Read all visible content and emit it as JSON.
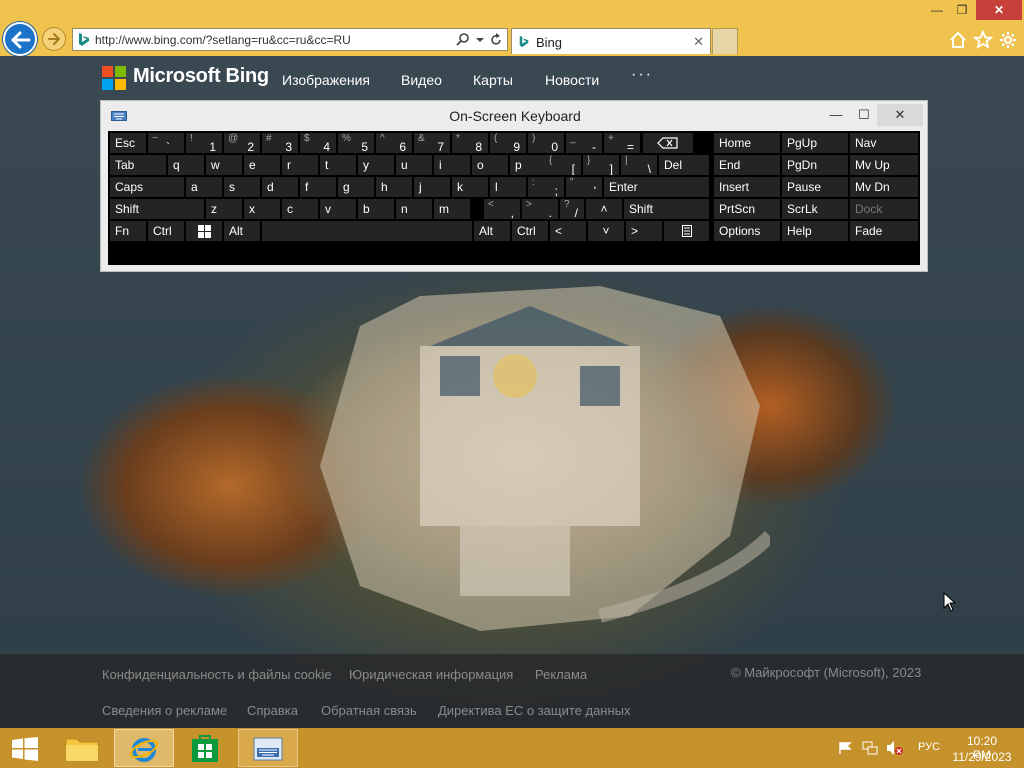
{
  "browser": {
    "address": "http://www.bing.com/?setlang=ru&cc=ru&cc=RU",
    "tab_title": "Bing",
    "tab_close": "✕",
    "win_min": "—",
    "win_max": "❐",
    "win_close": "✕"
  },
  "bing": {
    "brand": "Microsoft Bing",
    "nav": [
      "Изображения",
      "Видео",
      "Карты",
      "Новости"
    ],
    "more": "···",
    "footer_row1": [
      "Конфиденциальность и файлы cookie",
      "Юридическая информация",
      "Реклама"
    ],
    "copyright": "© Майкрософт (Microsoft), 2023",
    "footer_row2": [
      "Сведения о рекламе",
      "Справка",
      "Обратная связь",
      "Директива ЕС о защите данных"
    ]
  },
  "osk": {
    "title": "On-Screen Keyboard",
    "min": "—",
    "max": "☐",
    "close": "✕",
    "keys": {
      "esc": "Esc",
      "tab": "Tab",
      "caps": "Caps",
      "shift": "Shift",
      "fn": "Fn",
      "ctrl": "Ctrl",
      "alt": "Alt",
      "del": "Del",
      "enter": "Enter",
      "shift_r": "Shift",
      "alt_r": "Alt",
      "ctrl_r": "Ctrl",
      "tilde_sh": "~",
      "tilde": "`",
      "num": [
        [
          "!",
          "1"
        ],
        [
          "@",
          "2"
        ],
        [
          "#",
          "3"
        ],
        [
          "$",
          "4"
        ],
        [
          "%",
          "5"
        ],
        [
          "^",
          "6"
        ],
        [
          "&",
          "7"
        ],
        [
          "*",
          "8"
        ],
        [
          "(",
          "9"
        ],
        [
          ")",
          "0"
        ],
        [
          "_",
          "-"
        ],
        [
          "+",
          "="
        ]
      ],
      "row_q": [
        "q",
        "w",
        "e",
        "r",
        "t",
        "y",
        "u",
        "i",
        "o",
        "p"
      ],
      "bracket_l": [
        "{",
        "["
      ],
      "bracket_r": [
        "}",
        "]"
      ],
      "pipe": [
        "|",
        "\\"
      ],
      "row_a": [
        "a",
        "s",
        "d",
        "f",
        "g",
        "h",
        "j",
        "k",
        "l"
      ],
      "semi": [
        ":",
        ";"
      ],
      "quote": [
        "\"",
        "'"
      ],
      "row_z": [
        "z",
        "x",
        "c",
        "v",
        "b",
        "n",
        "m"
      ],
      "comma": [
        "<",
        ","
      ],
      "period": [
        ">",
        "."
      ],
      "slash": [
        "?",
        "/"
      ],
      "up": "˄",
      "left": "<",
      "down": "˅",
      "right": ">",
      "home": "Home",
      "pgup": "PgUp",
      "nav": "Nav",
      "end": "End",
      "pgdn": "PgDn",
      "mvup": "Mv Up",
      "insert": "Insert",
      "pause": "Pause",
      "mvdn": "Mv Dn",
      "prtscn": "PrtScn",
      "scrlk": "ScrLk",
      "dock": "Dock",
      "options": "Options",
      "help": "Help",
      "fade": "Fade"
    }
  },
  "tray": {
    "lang": "РУС",
    "time": "10:20 PM",
    "date": "11/29/2023"
  },
  "colors": {
    "ie_chrome": "#f0c34e",
    "taskbar": "#c5922b",
    "osk_key": "#242424",
    "win_close": "#c7403a"
  }
}
